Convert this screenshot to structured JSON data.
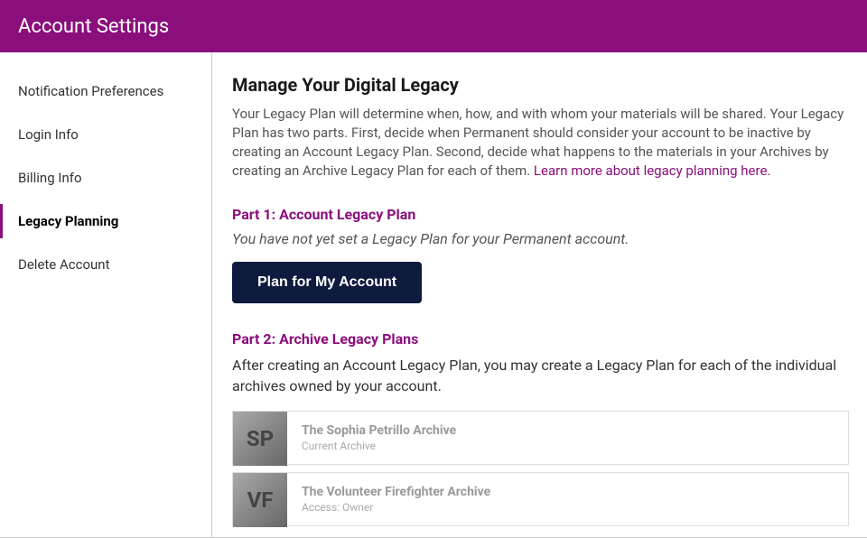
{
  "header": {
    "title": "Account Settings"
  },
  "sidebar": {
    "items": [
      {
        "label": "Notification Preferences"
      },
      {
        "label": "Login Info"
      },
      {
        "label": "Billing Info"
      },
      {
        "label": "Legacy Planning"
      },
      {
        "label": "Delete Account"
      }
    ]
  },
  "main": {
    "title": "Manage Your Digital Legacy",
    "description": "Your Legacy Plan will determine when, how, and with whom your materials will be shared. Your Legacy Plan has two parts. First, decide when Permanent should consider your account to be inactive by creating an Account Legacy Plan. Second, decide what happens to the materials in your Archives by creating an Archive Legacy Plan for each of them.  ",
    "learn_more": "Learn more about legacy planning here.",
    "part1": {
      "heading": "Part 1: Account Legacy Plan",
      "subtext": "You have not yet set a Legacy Plan for your Permanent account.",
      "button_label": "Plan for My Account"
    },
    "part2": {
      "heading": "Part 2: Archive Legacy Plans",
      "subtext": "After creating an Account Legacy Plan, you may create a Legacy Plan for each of the individual archives owned by your account.",
      "archives": [
        {
          "initials": "SP",
          "title": "The Sophia Petrillo Archive",
          "subtitle": "Current Archive"
        },
        {
          "initials": "VF",
          "title": "The Volunteer Firefighter Archive",
          "subtitle": "Access: Owner"
        }
      ]
    }
  }
}
